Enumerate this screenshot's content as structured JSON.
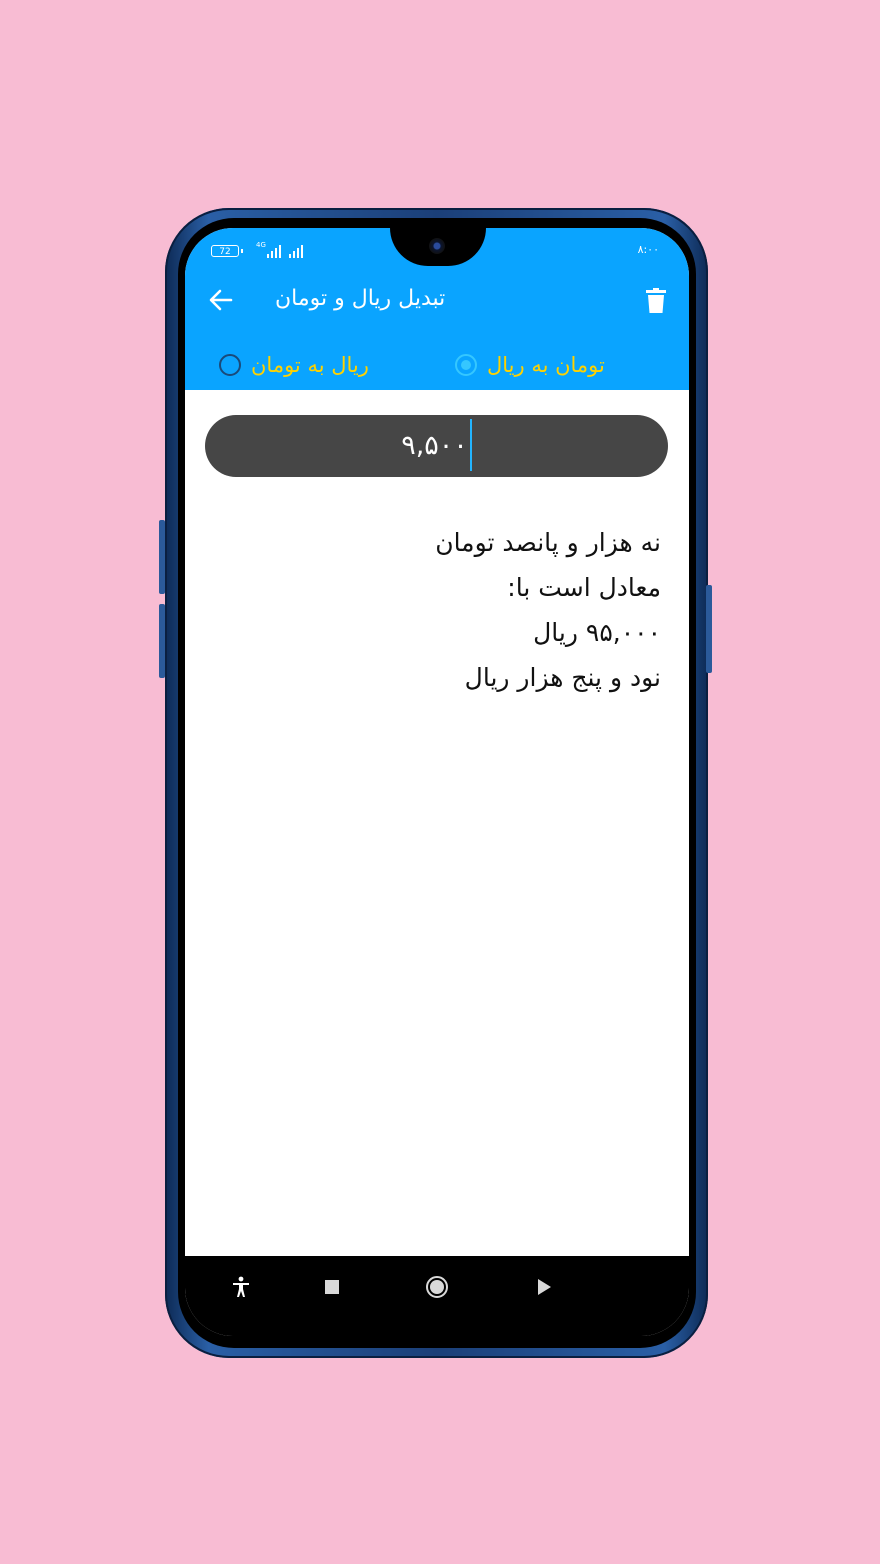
{
  "status_bar": {
    "battery": "72",
    "network": "4G",
    "time": "۸:۰۰"
  },
  "app_bar": {
    "title": "تبدیل ریال و تومان"
  },
  "mode": {
    "toman_to_rial": "تومان به ریال",
    "rial_to_toman": "ریال به تومان",
    "selected": "toman_to_rial"
  },
  "input": {
    "value": "۹,۵۰۰"
  },
  "result": {
    "line1": "نه هزار و پانصد تومان",
    "line2": "معادل است با:",
    "line3": "۹۵,۰۰۰ ریال",
    "line4": "نود و پنج هزار ریال"
  },
  "colors": {
    "accent": "#0aa4ff",
    "radio_label": "#ffd200",
    "background": "#f8bcd3",
    "input_bg": "#464646"
  },
  "icons": {
    "back": "arrow-left-icon",
    "delete": "trash-icon",
    "nav": [
      "accessibility-icon",
      "square-icon",
      "circle-icon",
      "triangle-icon"
    ]
  }
}
